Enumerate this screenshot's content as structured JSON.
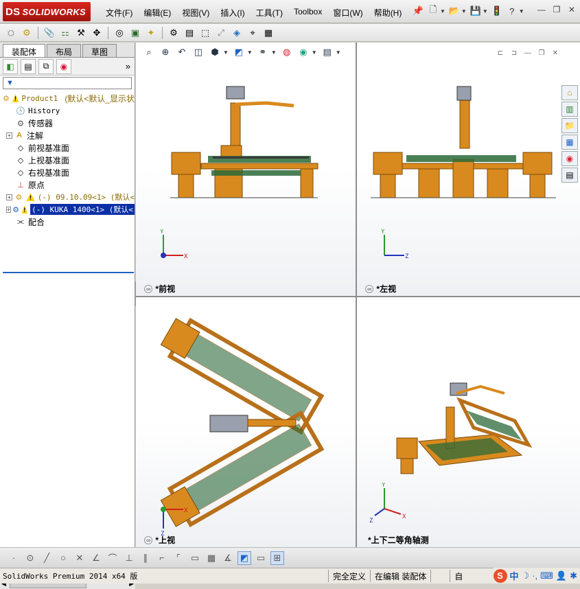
{
  "app": {
    "brand_prefix": "DS",
    "brand": "SOLIDWORKS",
    "accent_color": "#c4201a"
  },
  "menu": [
    "文件(F)",
    "编辑(E)",
    "视图(V)",
    "插入(I)",
    "工具(T)",
    "Toolbox",
    "窗口(W)",
    "帮助(H)"
  ],
  "quick_icons": [
    "pin-icon",
    "new-document-icon",
    "open-icon",
    "save-icon",
    "traffic-light-icon",
    "help-icon"
  ],
  "window_controls": [
    "minimize-icon",
    "restore-icon",
    "close-icon"
  ],
  "sidebar": {
    "tabs": [
      "装配体",
      "布局",
      "草图"
    ],
    "active_tab": "装配体",
    "tree": [
      {
        "label": "Product1",
        "suffix": "(默认<默认_显示状",
        "warning": true,
        "expandable": false,
        "icon": "assembly-icon"
      },
      {
        "label": "History",
        "icon": "history-icon"
      },
      {
        "label": "传感器",
        "icon": "sensor-icon"
      },
      {
        "label": "注解",
        "icon": "annotation-icon",
        "expandable": true
      },
      {
        "label": "前视基准面",
        "icon": "plane-icon"
      },
      {
        "label": "上视基准面",
        "icon": "plane-icon"
      },
      {
        "label": "右视基准面",
        "icon": "plane-icon"
      },
      {
        "label": "原点",
        "icon": "origin-icon"
      },
      {
        "label": "(-) 09.10.09<1> (默认<",
        "icon": "subassembly-icon",
        "warning": true,
        "expandable": true
      },
      {
        "label": "(-) KUKA 1400<1> (默认<",
        "icon": "subassembly-icon",
        "warning": true,
        "expandable": true,
        "selected": true
      },
      {
        "label": "配合",
        "icon": "mates-icon"
      }
    ]
  },
  "viewports": [
    {
      "id": "front",
      "label": "*前视",
      "axes": [
        "Y",
        "X"
      ]
    },
    {
      "id": "left",
      "label": "*左视",
      "axes": [
        "Y",
        "Z"
      ]
    },
    {
      "id": "top",
      "label": "*上视",
      "axes": [
        "X",
        "Z"
      ]
    },
    {
      "id": "iso",
      "label": "*上下二等角轴测",
      "axes": [
        "Y",
        "Z",
        "X"
      ]
    }
  ],
  "status": {
    "app": "SolidWorks Premium 2014 x64 版",
    "defined": "完全定义",
    "editing": "在编辑 装配体",
    "custom": "自"
  },
  "ime": {
    "logo": "S",
    "mode": "中"
  }
}
